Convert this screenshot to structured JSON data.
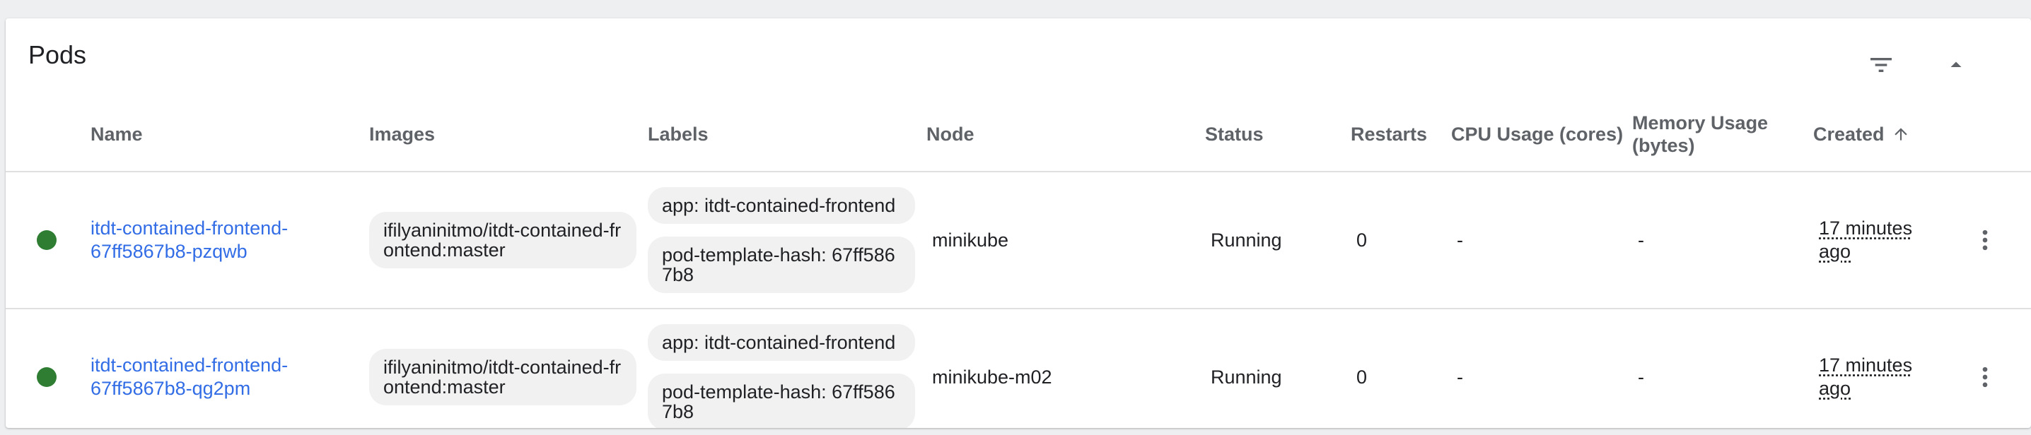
{
  "card": {
    "title": "Pods"
  },
  "icons": {
    "filter": "filter-icon",
    "collapse": "caret-up-icon",
    "sort": "arrow-up-icon",
    "status": "status-dot-icon",
    "menu": "more-vert-icon"
  },
  "colors": {
    "link": "#326de6",
    "status_running": "#2e7d32",
    "header_text": "#5f6368"
  },
  "table": {
    "columns": {
      "name": "Name",
      "images": "Images",
      "labels": "Labels",
      "node": "Node",
      "status": "Status",
      "restarts": "Restarts",
      "cpu": "CPU Usage (cores)",
      "memory": "Memory Usage (bytes)",
      "created": "Created"
    },
    "sort": {
      "column": "Created",
      "direction": "ascending"
    },
    "rows": [
      {
        "name": "itdt-contained-frontend-67ff5867b8-pzqwb",
        "image": "ifilyaninitmo/itdt-contained-frontend:master",
        "labels": [
          "app: itdt-contained-frontend",
          "pod-template-hash: 67ff5867b8"
        ],
        "node": "minikube",
        "status": "Running",
        "restarts": "0",
        "cpu": "-",
        "memory": "-",
        "created": "17 minutes ago"
      },
      {
        "name": "itdt-contained-frontend-67ff5867b8-qg2pm",
        "image": "ifilyaninitmo/itdt-contained-frontend:master",
        "labels": [
          "app: itdt-contained-frontend",
          "pod-template-hash: 67ff5867b8"
        ],
        "node": "minikube-m02",
        "status": "Running",
        "restarts": "0",
        "cpu": "-",
        "memory": "-",
        "created": "17 minutes ago"
      }
    ]
  }
}
